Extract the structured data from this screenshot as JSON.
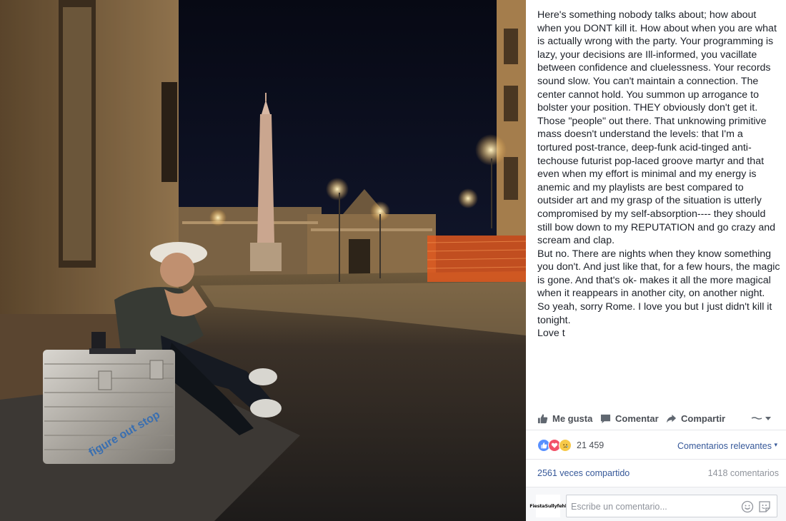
{
  "post": {
    "text": "Here's something nobody talks about; how about when you DONT kill it. How about when you are what is actually wrong with the party. Your programming is lazy, your decisions are Ill-informed, you vacillate between confidence and cluelessness. Your records sound slow. You can't maintain a connection. The center cannot hold. You summon up arrogance to bolster your position. THEY obviously don't get it. Those \"people\" out there. That unknowing primitive mass doesn't understand the levels: that I'm a tortured post-trance, deep-funk acid-tinged anti-techouse futurist pop-laced groove martyr and that even when my effort is minimal and my energy is anemic and my playlists are best compared to outsider art and my grasp of the situation is utterly compromised by my self-absorption---- they should still bow down to my REPUTATION and go crazy and scream and clap.\nBut no. There are nights when they know something you don't. And just like that, for a few hours, the magic is gone. And that's ok- makes it all the more magical when it reappears in another city, on another night.\nSo yeah, sorry Rome. I love you but I just didn't kill it tonight.\nLove t"
  },
  "photo": {
    "case_sticker": "figure out stop"
  },
  "actions": {
    "like": "Me gusta",
    "comment": "Comentar",
    "share": "Compartir",
    "viewer_icon": "page-avatar-dropdown-icon"
  },
  "stats": {
    "reactions": [
      "like-icon",
      "love-icon",
      "sad-icon"
    ],
    "reaction_count": "21 459",
    "sort_label": "Comentarios relevantes",
    "shares": "2561 veces compartido",
    "comments": "1418 comentarios"
  },
  "composer": {
    "avatar_text": "FiestaSullyfehl",
    "placeholder": "Escribe un comentario..."
  },
  "colors": {
    "link": "#365899",
    "like_blue": "#5890ff",
    "love_red": "#f25268",
    "sad_yellow": "#f7c948"
  }
}
